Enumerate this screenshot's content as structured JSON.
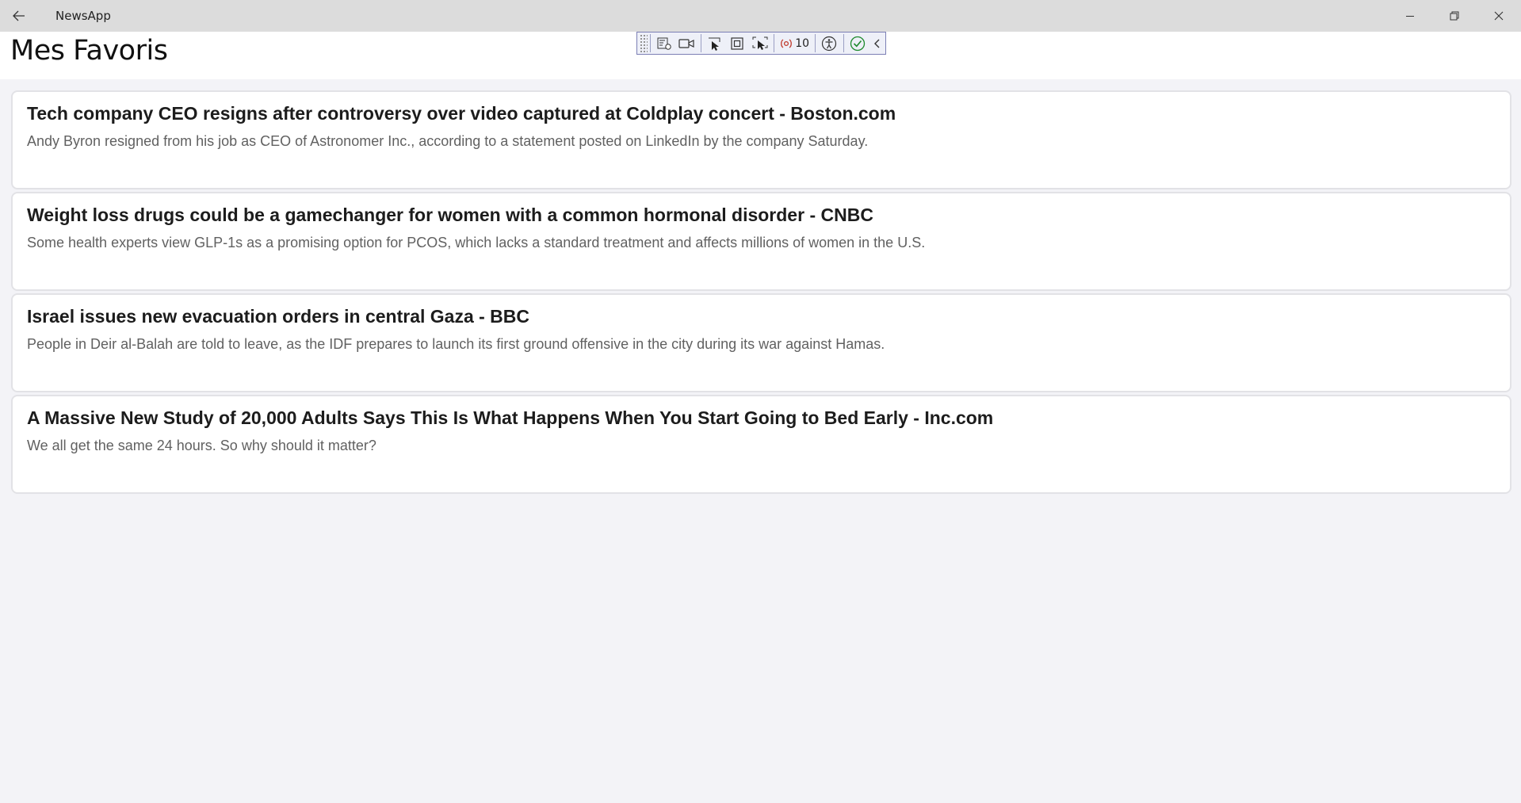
{
  "window": {
    "app_title": "NewsApp",
    "back_icon": "arrow-left-icon",
    "minimize_icon": "minimize-icon",
    "restore_icon": "restore-icon",
    "close_icon": "close-icon"
  },
  "page": {
    "title": "Mes Favoris"
  },
  "debug_toolbar": {
    "icons": [
      "live-visual-tree-icon",
      "video-camera-icon",
      "select-element-icon",
      "display-layout-adorners-icon",
      "track-focus-icon",
      "binding-failures-icon",
      "accessibility-icon",
      "checkmark-icon",
      "collapse-chevron-icon"
    ],
    "binding_failures_count": "10"
  },
  "articles": [
    {
      "title": "Tech company CEO resigns after controversy over video captured at Coldplay concert - Boston.com",
      "description": "Andy Byron resigned from his job as CEO of Astronomer Inc., according to a statement posted on LinkedIn by the company Saturday."
    },
    {
      "title": "Weight loss drugs could be a gamechanger for women with a common hormonal disorder - CNBC",
      "description": "Some health experts view GLP-1s as a promising option for PCOS, which lacks a standard treatment and affects millions of women in the U.S."
    },
    {
      "title": "Israel issues new evacuation orders in central Gaza - BBC",
      "description": "People in Deir al-Balah are told to leave, as the IDF prepares to launch its first ground offensive in the city during its war against Hamas."
    },
    {
      "title": "A Massive New Study of 20,000 Adults Says This Is What Happens When You Start Going to Bed Early - Inc.com",
      "description": "We all get the same 24 hours. So why should it matter?"
    }
  ]
}
